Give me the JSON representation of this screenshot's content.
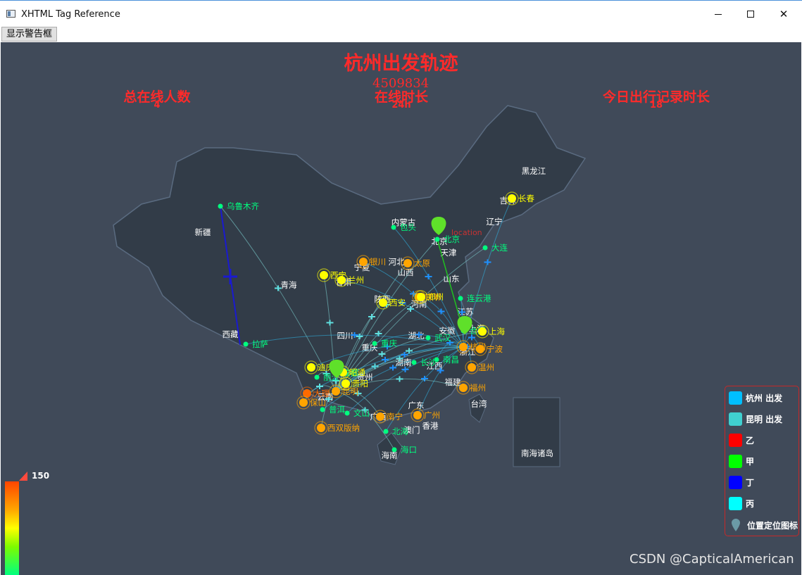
{
  "window": {
    "title": "XHTML Tag Reference",
    "controls": {
      "minimize": "",
      "maximize": "",
      "close": "✕"
    }
  },
  "toolbar": {
    "alert_button": "显示警告框"
  },
  "chart": {
    "headline": "杭州出发轨迹",
    "stats": [
      {
        "label": "总在线人数",
        "value": "4"
      },
      {
        "label": "在线时长",
        "value": "24h",
        "big": "4509834"
      },
      {
        "label": "今日出行记录时长",
        "value": "18"
      }
    ],
    "provinces": [
      "黑龙江",
      "吉林",
      "辽宁",
      "内蒙古",
      "北京",
      "天津",
      "新疆",
      "青海",
      "西藏",
      "宁夏",
      "甘肃",
      "山西",
      "河北",
      "山东",
      "陕西",
      "河南",
      "江苏",
      "安徽",
      "湖北",
      "四川",
      "重庆",
      "浙江",
      "上海",
      "贵州",
      "湖南",
      "江西",
      "福建",
      "云南",
      "广西",
      "广东",
      "台湾",
      "香港",
      "澳门",
      "海南",
      "南海诸岛"
    ],
    "cities": [
      "乌鲁木齐",
      "长春",
      "大连",
      "包头",
      "北京",
      "银川",
      "西宁",
      "兰州",
      "太原",
      "邯郸",
      "郑州",
      "连云港",
      "西安",
      "合肥",
      "上海",
      "宁波",
      "杭州",
      "温州",
      "武汉",
      "南昌",
      "长沙",
      "重庆",
      "成都",
      "拉萨",
      "昆明",
      "迪庆",
      "丽江",
      "大理",
      "保山",
      "普洱",
      "西双版纳",
      "文山",
      "南宁",
      "北海",
      "海口",
      "广州",
      "福州",
      "贵阳",
      "昭通"
    ],
    "misc_label": "location",
    "legend": [
      {
        "label": "杭州 出发",
        "color": "#00bfff"
      },
      {
        "label": "昆明 出发",
        "color": "#40d0d0"
      },
      {
        "label": "乙",
        "color": "#ff0000"
      },
      {
        "label": "甲",
        "color": "#00ff00"
      },
      {
        "label": "丁",
        "color": "#0000ff"
      },
      {
        "label": "丙",
        "color": "#00ffff"
      },
      {
        "label": "位置定位图标",
        "icon": "map-pin-icon"
      }
    ],
    "visual_map_max": "150"
  },
  "watermark": "CSDN @CapticalAmerican"
}
